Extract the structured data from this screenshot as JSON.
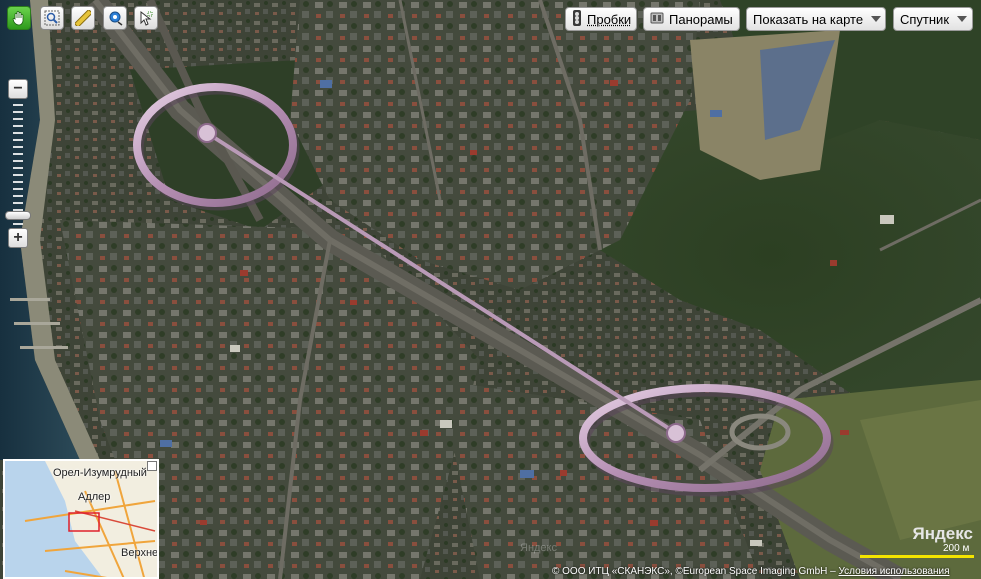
{
  "toolbar": {
    "tools": [
      {
        "name": "hand-tool",
        "icon": "hand-icon",
        "active": true
      },
      {
        "name": "magnifier-tool",
        "icon": "magnifier-icon",
        "active": false
      },
      {
        "name": "ruler-tool",
        "icon": "ruler-icon",
        "active": false
      },
      {
        "name": "route-tool",
        "icon": "route-icon",
        "active": false
      },
      {
        "name": "pointer-tool",
        "icon": "pointer-icon",
        "active": false
      }
    ]
  },
  "controls": {
    "traffic_label": "Пробки",
    "panoramas_label": "Панорамы",
    "show_on_map_label": "Показать на карте",
    "map_type_label": "Спутник"
  },
  "zoom": {
    "minus": "−",
    "plus": "+",
    "level_fraction": 0.88
  },
  "overview": {
    "labels": {
      "orel": "Орел-Изумрудный",
      "adler": "Адлер",
      "verkhne": "Верхне"
    }
  },
  "logo": "Яндекс",
  "scale": "200 м",
  "copyright": {
    "text": "© ООО ИТЦ «СКАНЭКС», ©European Space Imaging GmbH –",
    "terms": "Условия использования"
  },
  "watermark": "Яндекс",
  "colors": {
    "active_tool": "#3aa524",
    "scale_bar": "#f4e400",
    "ring": "#c8a6c6"
  }
}
